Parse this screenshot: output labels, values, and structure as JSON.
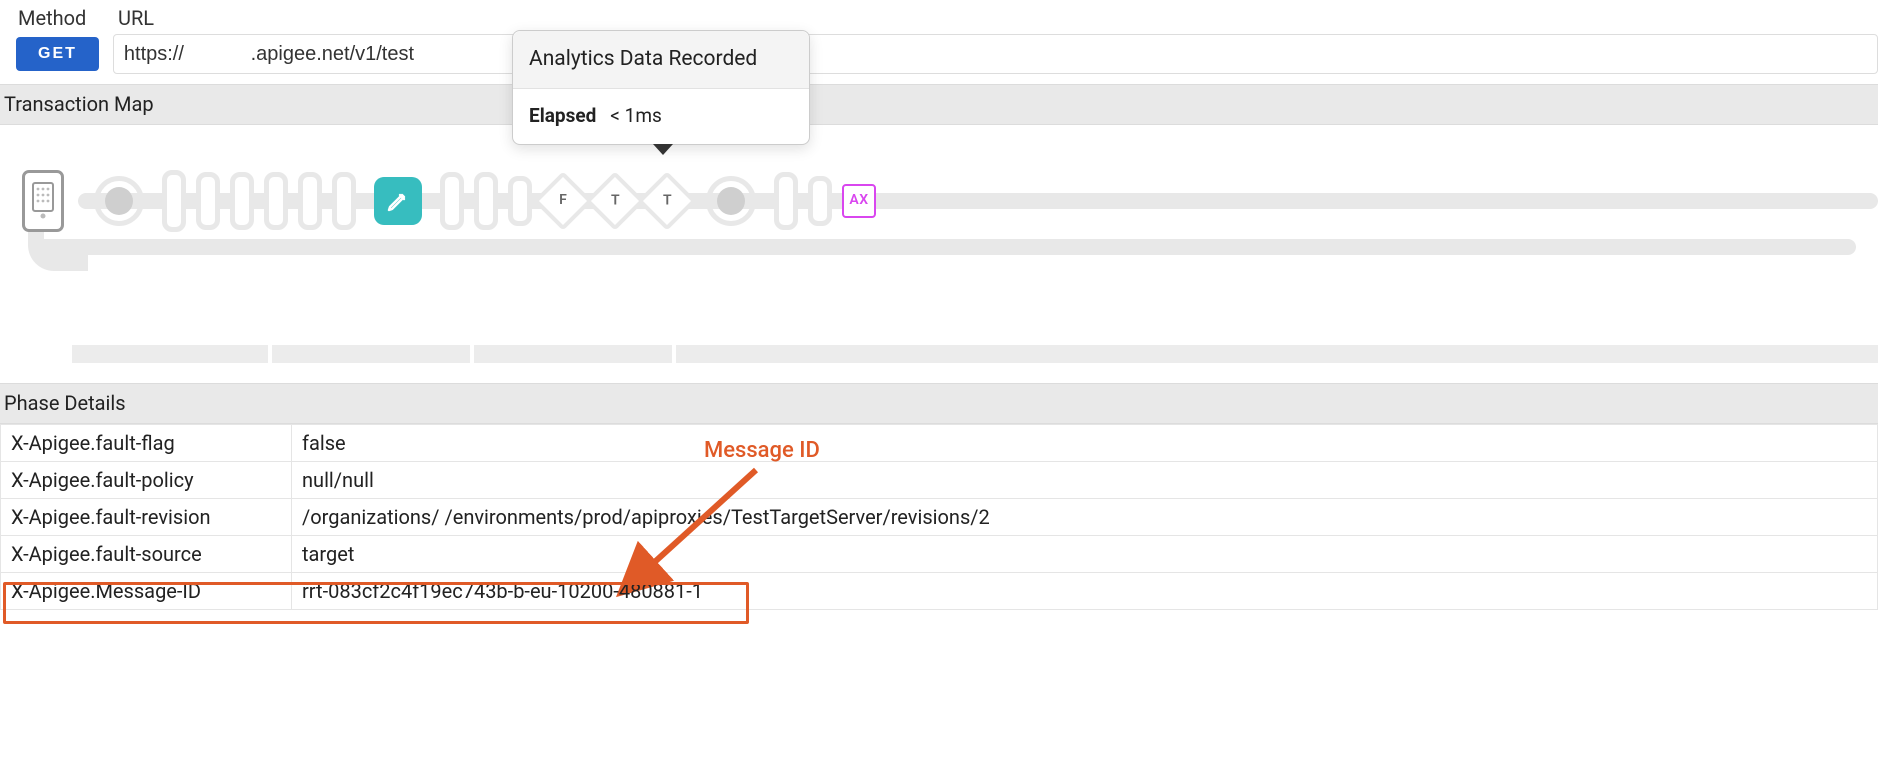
{
  "colors": {
    "accent_blue": "#2563c9",
    "accent_teal": "#37bdbf",
    "accent_magenta": "#d946ef",
    "accent_orange": "#e05a27"
  },
  "top": {
    "method_label": "Method",
    "url_label": "URL",
    "method_button": "GET",
    "url_value": "https://            .apigee.net/v1/test"
  },
  "sections": {
    "transaction_map": "Transaction Map",
    "phase_details": "Phase Details"
  },
  "tooltip": {
    "title": "Analytics Data Recorded",
    "elapsed_label": "Elapsed",
    "elapsed_value": "< 1ms"
  },
  "tx_map": {
    "diamonds": [
      "F",
      "T",
      "T"
    ],
    "ax_label": "AX"
  },
  "annotation": {
    "label": "Message ID"
  },
  "phase_rows": [
    {
      "key": "X-Apigee.fault-flag",
      "value": "false"
    },
    {
      "key": "X-Apigee.fault-policy",
      "value": "null/null"
    },
    {
      "key": "X-Apigee.fault-revision",
      "value": "/organizations/        /environments/prod/apiproxies/TestTargetServer/revisions/2"
    },
    {
      "key": "X-Apigee.fault-source",
      "value": "target"
    },
    {
      "key": "X-Apigee.Message-ID",
      "value": "rrt-083cf2c4f19ec743b-b-eu-10200-480881-1"
    }
  ]
}
